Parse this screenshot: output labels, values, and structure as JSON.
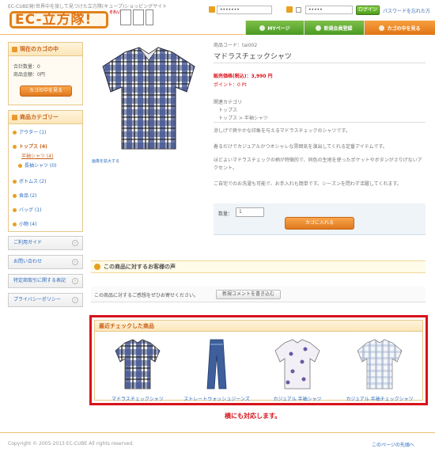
{
  "header": {
    "tagline": "EC-CUBE発!世界中を旅して見つけた立方隊(キューブ)ショッピングサイト",
    "logo_text": "EC-立方隊!",
    "logo_badge": "それいけ!",
    "login": {
      "email_value": "•••••••",
      "password_value": "•••••",
      "login_button": "ログイン",
      "forgot_link": "パスワードを忘れた方"
    },
    "nav": [
      {
        "label": "MYページ"
      },
      {
        "label": "新規会員登録"
      },
      {
        "label": "カゴの中を見る"
      }
    ]
  },
  "sidebar": {
    "cart": {
      "title": "現在のカゴの中",
      "count_line": "合計数量：0",
      "total_line": "商品金額：0円",
      "button": "カゴの中を見る"
    },
    "categories": {
      "title": "商品カテゴリー",
      "items": [
        {
          "label": "アウター (1)"
        },
        {
          "label": "トップス (4)"
        },
        {
          "label": "半袖シャツ (4)"
        },
        {
          "label": "長袖シャツ (0)"
        },
        {
          "label": "ボトムス (2)"
        },
        {
          "label": "食品 (2)"
        },
        {
          "label": "バッグ (1)"
        },
        {
          "label": "小物 (4)"
        }
      ]
    },
    "links": [
      {
        "label": "ご利用ガイド"
      },
      {
        "label": "お問い合わせ"
      },
      {
        "label": "特定商取引に関する表記"
      },
      {
        "label": "プライバシーポリシー"
      }
    ]
  },
  "product": {
    "enlarge_link": "画像を拡大する",
    "code": "商品コード：tai002",
    "name": "マドラスチェックシャツ",
    "price": "販売価格(税込)：3,990 円",
    "points": "ポイント：0 Pt",
    "related_label": "関連カテゴリ",
    "related": [
      "トップス",
      "トップス > 半袖シャツ"
    ],
    "description": [
      "涼しげで爽やかな印象を与えるマドラスチェックのシャツです。",
      "着るだけでカジュアルかつオシャレな雰囲気を演出してくれる定番アイテムです。",
      "ほどよいマドラスチェックの柄が特徴的で、同色の生地を使ったポケットやボタンがさりげないアクセント。",
      "ご自宅でのお洗濯も可能で、お手入れも簡単です。シーズンを問わず活躍してくれます。"
    ],
    "quantity_label": "数量：",
    "quantity_value": "1",
    "add_to_cart": "カゴに入れる"
  },
  "review": {
    "title": "この商品に対するお客様の声",
    "empty_text": "この商品に対するご感想をぜひお寄せください。",
    "button": "新規コメントを書き込む"
  },
  "recent": {
    "title": "最近チェックした商品",
    "items": [
      {
        "label": "マドラスチェックシャツ",
        "kind": "plaid-shirt"
      },
      {
        "label": "ストレートウォッシュジーンズ",
        "kind": "jeans"
      },
      {
        "label": "カジュアル 半袖シャツ",
        "kind": "dot-shirt"
      },
      {
        "label": "カジュアル 半袖チェックシャツ",
        "kind": "check-shirt"
      }
    ],
    "caption": "横にも対応します。"
  },
  "footer": {
    "copyright": "Copyright © 2005-2013 EC-CUBE All rights reserved.",
    "pagetop": "このページの先頭へ"
  },
  "colors": {
    "accent": "#e07414",
    "highlight": "#d8121a",
    "link": "#2a6bbf"
  }
}
